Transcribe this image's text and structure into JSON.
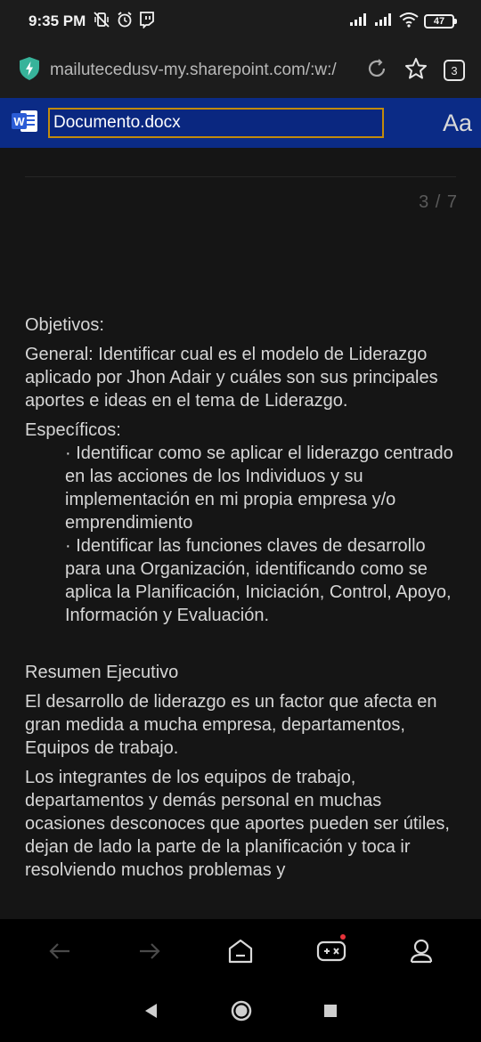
{
  "status_bar": {
    "time": "9:35 PM",
    "battery": "47",
    "icons": [
      "vibrate-off-icon",
      "alarm-icon",
      "twitch-icon",
      "signal-icon",
      "signal-icon",
      "wifi-icon",
      "battery-icon"
    ]
  },
  "browser": {
    "url": "mailutecedusv-my.sharepoint.com/:w:/",
    "tab_count": "3",
    "icons": [
      "shield-icon",
      "reload-icon",
      "star-icon"
    ]
  },
  "word": {
    "title": "Documento.docx",
    "font_button": "Aa",
    "icons": [
      "word-logo-icon"
    ]
  },
  "document": {
    "page_indicator": "3 / 7",
    "objetivos_heading": "Objetivos:",
    "general": "General: Identificar cual es el modelo de Liderazgo aplicado por Jhon Adair y cuáles son sus principales aportes e ideas en el tema de Liderazgo.",
    "especificos_heading": "Específicos:",
    "especificos_items": [
      "· Identificar como se aplicar el liderazgo centrado en las acciones de los Individuos y su implementación en mi propia empresa y/o emprendimiento",
      "· Identificar las funciones claves de desarrollo para una Organización, identificando como se aplica la Planificación, Iniciación, Control, Apoyo, Información y Evaluación."
    ],
    "resumen_heading": "Resumen Ejecutivo",
    "resumen_p1": "El desarrollo de liderazgo es un factor que afecta en gran medida a mucha empresa, departamentos, Equipos de trabajo.",
    "resumen_p2": "Los integrantes de los equipos de trabajo, departamentos y demás personal en muchas ocasiones desconoces que aportes pueden ser útiles, dejan de lado la parte de la planificación y toca ir resolviendo muchos problemas y"
  },
  "bottom_nav": {
    "icons": [
      "back-arrow-icon",
      "forward-arrow-icon",
      "home-icon",
      "games-icon",
      "profile-icon"
    ],
    "notification_color": "#e8333b"
  },
  "system_nav": {
    "icons": [
      "back-triangle-icon",
      "home-circle-icon",
      "recents-square-icon"
    ]
  },
  "colors": {
    "word_header": "#0b2b86",
    "title_border": "#c28b0c",
    "document_bg": "#151515",
    "text": "#d6d6d6"
  }
}
